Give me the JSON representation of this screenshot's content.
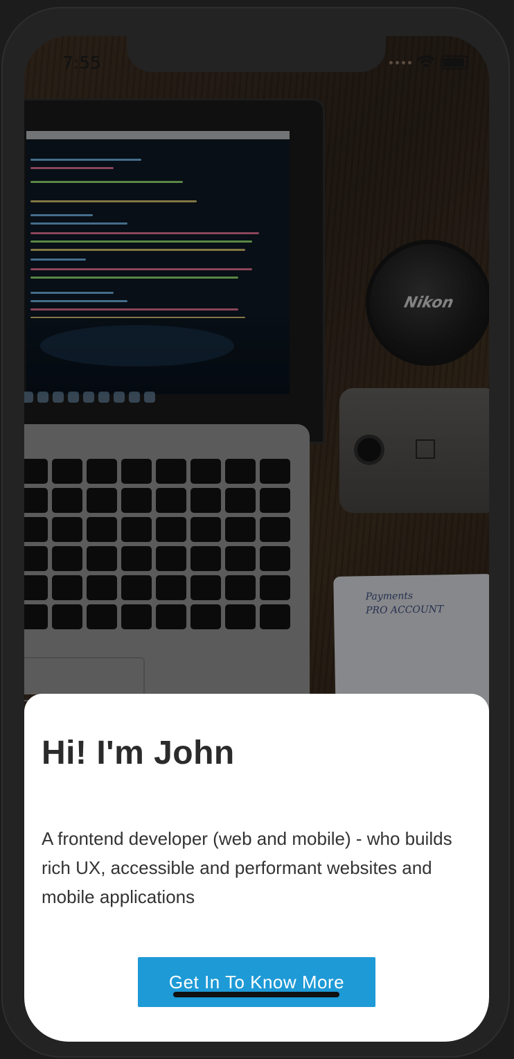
{
  "status_bar": {
    "time": "7:55",
    "icons": [
      "cellular-dots-icon",
      "wifi-icon",
      "battery-icon"
    ]
  },
  "background": {
    "description_icons": [
      "laptop-icon",
      "camera-lens-icon",
      "smartphone-icon",
      "notebook-icon"
    ],
    "lens_brand": "Nikon",
    "notebook_text": [
      "Payments",
      "PRO ACCOUNT"
    ]
  },
  "hero": {
    "title": "Hi! I'm John",
    "description": "A frontend developer (web and mobile) - who builds rich UX, accessible and performant websites and mobile applications",
    "cta_label": "Get In To Know More"
  },
  "colors": {
    "accent": "#1e9ad6",
    "title_text": "#2b2b2b",
    "card_bg": "#ffffff"
  }
}
